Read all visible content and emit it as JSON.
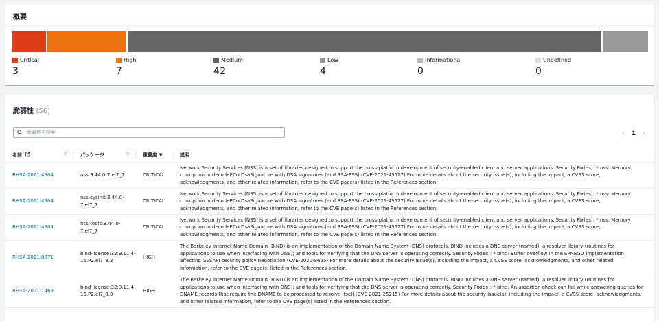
{
  "summary": {
    "title": "概要",
    "total": 56,
    "segments": [
      {
        "label": "Critical",
        "count": "3",
        "value": 3,
        "color": "#dd3e1a"
      },
      {
        "label": "High",
        "count": "7",
        "value": 7,
        "color": "#ec7211"
      },
      {
        "label": "Medium",
        "count": "42",
        "value": 42,
        "color": "#666666"
      },
      {
        "label": "Low",
        "count": "4",
        "value": 4,
        "color": "#999999"
      },
      {
        "label": "Informational",
        "count": "0",
        "value": 0,
        "color": "#bdbdbd"
      },
      {
        "label": "Undefined",
        "count": "0",
        "value": 0,
        "color": "#dedede"
      }
    ]
  },
  "vulns": {
    "title": "脆弱性",
    "count_label": "(56)",
    "search_placeholder": "脆弱性を検索",
    "pager": {
      "prev": "‹",
      "page": "1",
      "next": "›"
    },
    "columns": {
      "name": "名前",
      "package": "パッケージ",
      "severity": "重要度",
      "severity_sort": "▼",
      "description": "説明"
    },
    "rows": [
      {
        "name": "RHSA-2021:4904",
        "package": "nss:3.44.0-7.el7_7",
        "severity": "CRITICAL",
        "description": "Network Security Services (NSS) is a set of libraries designed to support the cross-platform development of security-enabled client and server applications. Security Fix(es): * nss: Memory corruption in decodeECorDsaSignature with DSA signatures (and RSA-PSS) (CVE-2021-43527) For more details about the security issue(s), including the impact, a CVSS score, acknowledgments, and other related information, refer to the CVE page(s) listed in the References section."
      },
      {
        "name": "RHSA-2021:4904",
        "package": "nss-sysinit:3.44.0-7.el7_7",
        "severity": "CRITICAL",
        "description": "Network Security Services (NSS) is a set of libraries designed to support the cross-platform development of security-enabled client and server applications. Security Fix(es): * nss: Memory corruption in decodeECorDsaSignature with DSA signatures (and RSA-PSS) (CVE-2021-43527) For more details about the security issue(s), including the impact, a CVSS score, acknowledgments, and other related information, refer to the CVE page(s) listed in the References section."
      },
      {
        "name": "RHSA-2021:4904",
        "package": "nss-tools:3.44.0-7.el7_7",
        "severity": "CRITICAL",
        "description": "Network Security Services (NSS) is a set of libraries designed to support the cross-platform development of security-enabled client and server applications. Security Fix(es): * nss: Memory corruption in decodeECorDsaSignature with DSA signatures (and RSA-PSS) (CVE-2021-43527) For more details about the security issue(s), including the impact, a CVSS score, acknowledgments, and other related information, refer to the CVE page(s) listed in the References section."
      },
      {
        "name": "RHSA-2021:0671",
        "package": "bind-license:32:9.11.4-16.P2.el7_8.3",
        "severity": "HIGH",
        "description": "The Berkeley Internet Name Domain (BIND) is an implementation of the Domain Name System (DNS) protocols. BIND includes a DNS server (named); a resolver library (routines for applications to use when interfacing with DNS); and tools for verifying that the DNS server is operating correctly. Security Fix(es): * bind: Buffer overflow in the SPNEGO implementation affecting GSSAPI security policy negotiation (CVE-2020-8625) For more details about the security issue(s), including the impact, a CVSS score, acknowledgments, and other related information, refer to the CVE page(s) listed in the References section."
      },
      {
        "name": "RHSA-2021:1469",
        "package": "bind-license:32:9.11.4-16.P2.el7_8.3",
        "severity": "HIGH",
        "description": "The Berkeley Internet Name Domain (BIND) is an implementation of the Domain Name System (DNS) protocols. BIND includes a DNS server (named); a resolver library (routines for applications to use when interfacing with DNS); and tools for verifying that the DNS server is operating correctly. Security Fix(es): * bind: An assertion check can fail while answering queries for DNAME records that require the DNAME to be processed to resolve itself (CVE-2021-25215) For more details about the security issue(s), including the impact, a CVSS score, acknowledgments, and other related information, refer to the CVE page(s) listed in the References section."
      }
    ]
  }
}
